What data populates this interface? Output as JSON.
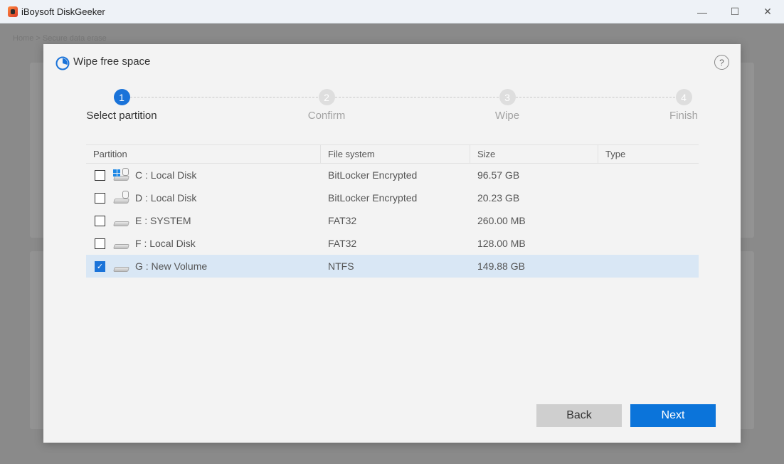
{
  "window": {
    "title": "iBoysoft DiskGeeker",
    "minimize": "—",
    "maximize": "☐",
    "close": "✕"
  },
  "background": {
    "breadcrumb": "Home > Secure data erase"
  },
  "dialog": {
    "title": "Wipe free space",
    "help": "?"
  },
  "steps": [
    {
      "number": "1",
      "label": "Select partition",
      "active": true
    },
    {
      "number": "2",
      "label": "Confirm",
      "active": false
    },
    {
      "number": "3",
      "label": "Wipe",
      "active": false
    },
    {
      "number": "4",
      "label": "Finish",
      "active": false
    }
  ],
  "table": {
    "headers": [
      "Partition",
      "File system",
      "Size",
      "Type"
    ],
    "rows": [
      {
        "name": "C : Local Disk",
        "fs": "BitLocker Encrypted",
        "size": "96.57 GB",
        "type": "",
        "checked": false,
        "icon": "windows-locked-disk-icon"
      },
      {
        "name": "D : Local Disk",
        "fs": "BitLocker Encrypted",
        "size": "20.23 GB",
        "type": "",
        "checked": false,
        "icon": "locked-disk-icon"
      },
      {
        "name": "E : SYSTEM",
        "fs": "FAT32",
        "size": "260.00 MB",
        "type": "",
        "checked": false,
        "icon": "disk-icon"
      },
      {
        "name": "F : Local Disk",
        "fs": "FAT32",
        "size": "128.00 MB",
        "type": "",
        "checked": false,
        "icon": "disk-icon"
      },
      {
        "name": "G : New Volume",
        "fs": "NTFS",
        "size": "149.88 GB",
        "type": "",
        "checked": true,
        "icon": "disk-icon"
      }
    ]
  },
  "buttons": {
    "back": "Back",
    "next": "Next"
  },
  "colors": {
    "accent": "#0b74da",
    "selected_row": "#d9e7f5"
  }
}
